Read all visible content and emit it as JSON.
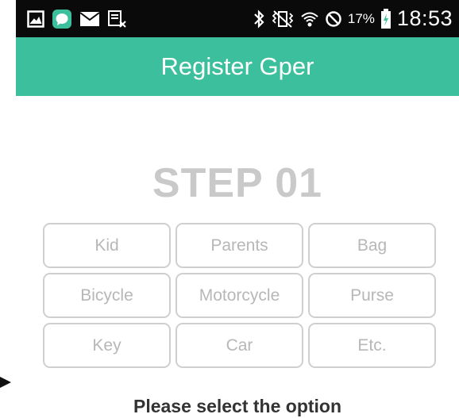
{
  "status_bar": {
    "left_icons": [
      "gallery-icon",
      "messenger-icon",
      "mail-icon",
      "screenshot-icon"
    ],
    "right_icons": [
      "bluetooth-icon",
      "vibrate-icon",
      "wifi-icon",
      "blocked-icon",
      "battery-icon"
    ],
    "battery_percent": "17%",
    "time": "18:53"
  },
  "app_bar": {
    "title": "Register Gper",
    "color": "#3bbf9c"
  },
  "step": {
    "title": "STEP 01"
  },
  "options": {
    "row1": [
      "Kid",
      "Parents",
      "Bag"
    ],
    "row2": [
      "Bicycle",
      "Motorcycle",
      "Purse"
    ],
    "row3": [
      "Key",
      "Car",
      "Etc."
    ]
  },
  "instruction": "Please select the option"
}
